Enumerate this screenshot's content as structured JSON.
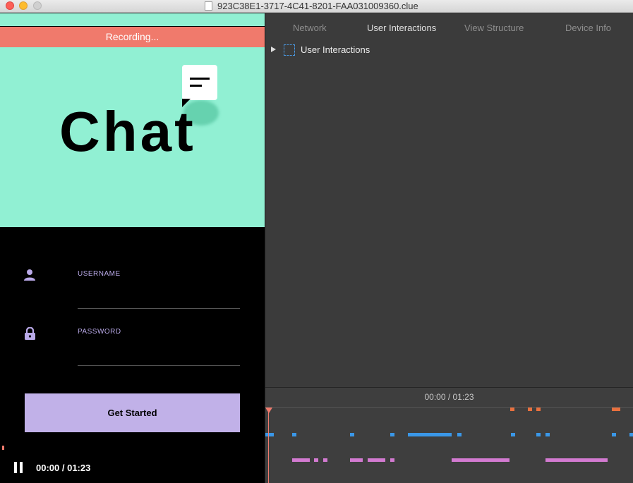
{
  "window": {
    "title": "923C38E1-3717-4C41-8201-FAA031009360.clue"
  },
  "app": {
    "recording_label": "Recording...",
    "hero_title": "Chat",
    "username_label": "USERNAME",
    "password_label": "PASSWORD",
    "get_started_label": "Get Started",
    "player_time": "00:00 / 01:23"
  },
  "inspector": {
    "tabs": [
      {
        "label": "Network",
        "active": false
      },
      {
        "label": "User Interactions",
        "active": true
      },
      {
        "label": "View Structure",
        "active": false
      },
      {
        "label": "Device Info",
        "active": false
      }
    ],
    "tree_root_label": "User Interactions"
  },
  "timeline": {
    "time": "00:00 / 01:23",
    "colors": {
      "network": "#e8703e",
      "view": "#3a97e8",
      "interaction": "#d37ad1",
      "playhead": "#f07a6c"
    }
  }
}
